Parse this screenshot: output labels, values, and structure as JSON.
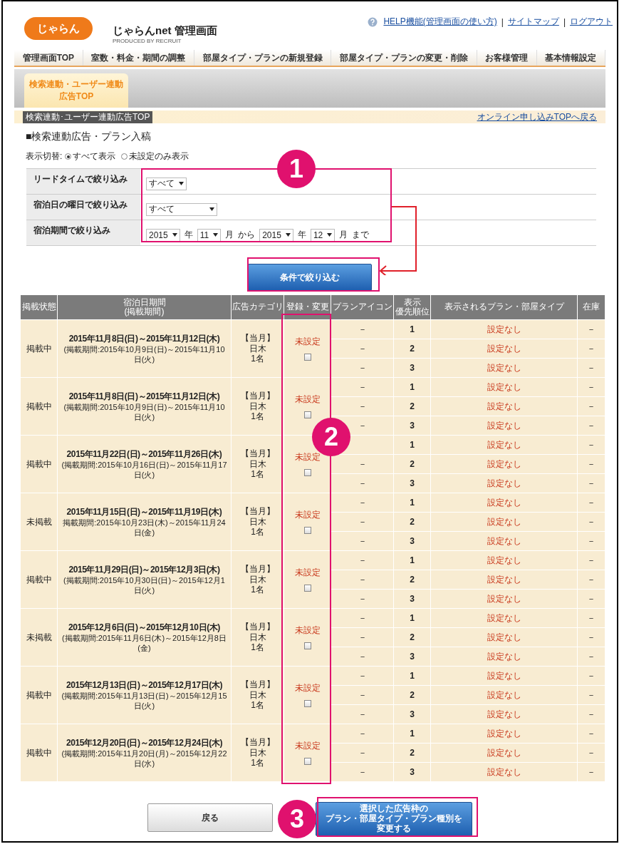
{
  "header": {
    "logo": "じゃらん",
    "title": "じゃらんnet 管理画面",
    "produced_by": "PRODUCED BY RECRUIT",
    "links": [
      {
        "kind": "help",
        "label": "HELP機能(管理画面の使い方)"
      },
      {
        "kind": "sep",
        "label": "|"
      },
      {
        "kind": "link",
        "label": "サイトマップ"
      },
      {
        "kind": "sep",
        "label": "|"
      },
      {
        "kind": "link",
        "label": "ログアウト"
      }
    ]
  },
  "nav": [
    "管理画面TOP",
    "室数・料金・期間の調整",
    "部屋タイプ・プランの新規登録",
    "部屋タイプ・プランの変更・削除",
    "お客様管理",
    "基本情報設定"
  ],
  "subtabs": [
    {
      "lines": [
        "検索連動・ユーザー連動",
        "広告TOP"
      ],
      "selected": true
    }
  ],
  "breadcrumb": {
    "current": "検索連動･ユーザー連動広告TOP",
    "back_link": "オンライン申し込みTOPへ戻る"
  },
  "heading": "■検索連動広告・プラン入稿",
  "display_toggle": {
    "label": "表示切替:",
    "options": [
      {
        "label": "すべて表示",
        "selected": true
      },
      {
        "label": "未設定のみ表示",
        "selected": false
      }
    ]
  },
  "filters": [
    {
      "label": "リードタイムで絞り込み",
      "controls": [
        {
          "kind": "select",
          "value": "すべて"
        }
      ]
    },
    {
      "label": "宿泊日の曜日で絞り込み",
      "controls": [
        {
          "kind": "select",
          "value": "すべて"
        }
      ]
    },
    {
      "label": "宿泊期間で絞り込み",
      "controls": [
        {
          "kind": "select",
          "value": "2015"
        },
        {
          "kind": "text",
          "value": "年"
        },
        {
          "kind": "select",
          "value": "11"
        },
        {
          "kind": "text",
          "value": "月"
        },
        {
          "kind": "text",
          "value": "から"
        },
        {
          "kind": "select",
          "value": "2015"
        },
        {
          "kind": "text",
          "value": "年"
        },
        {
          "kind": "select",
          "value": "12"
        },
        {
          "kind": "text",
          "value": "月"
        },
        {
          "kind": "text",
          "value": "まで"
        }
      ]
    }
  ],
  "filter_button": "条件で絞り込む",
  "table": {
    "columns": [
      {
        "lines": [
          "掲載状態"
        ]
      },
      {
        "lines": [
          "宿泊日期間",
          "(掲載期間)"
        ]
      },
      {
        "lines": [
          "広告カテゴリ"
        ]
      },
      {
        "lines": [
          "登録・変更"
        ]
      },
      {
        "lines": [
          "プランアイコン"
        ]
      },
      {
        "lines": [
          "表示",
          "優先順位"
        ]
      },
      {
        "lines": [
          "表示されるプラン・部屋タイプ"
        ]
      },
      {
        "lines": [
          "在庫"
        ]
      }
    ],
    "rows": [
      {
        "status": "掲載中",
        "stay": "2015年11月8日(日)～2015年11月12日(木)",
        "published": "(掲載期間:2015年10月9日(日)～2015年11月10日(火)",
        "category": [
          "【当月】",
          "日木",
          "1名"
        ],
        "registration": "未設定",
        "checked": false,
        "slots": [
          {
            "icon": "－",
            "priority": "1",
            "plan": "設定なし",
            "stock": "－"
          },
          {
            "icon": "－",
            "priority": "2",
            "plan": "設定なし",
            "stock": "－"
          },
          {
            "icon": "－",
            "priority": "3",
            "plan": "設定なし",
            "stock": "－"
          }
        ]
      },
      {
        "status": "掲載中",
        "stay": "2015年11月8日(日)～2015年11月12日(木)",
        "published": "(掲載期間:2015年10月9日(日)～2015年11月10日(火)",
        "category": [
          "【当月】",
          "日木",
          "1名"
        ],
        "registration": "未設定",
        "checked": false,
        "slots": [
          {
            "icon": "－",
            "priority": "1",
            "plan": "設定なし",
            "stock": "－"
          },
          {
            "icon": "－",
            "priority": "2",
            "plan": "設定なし",
            "stock": "－"
          },
          {
            "icon": "－",
            "priority": "3",
            "plan": "設定なし",
            "stock": "－"
          }
        ]
      },
      {
        "status": "掲載中",
        "stay": "2015年11月22日(日)～2015年11月26日(木)",
        "published": "(掲載期間:2015年10月16日(日)～2015年11月17日(火)",
        "category": [
          "【当月】",
          "日木",
          "1名"
        ],
        "registration": "未設定",
        "checked": false,
        "slots": [
          {
            "priority": "1",
            "plan": "設定なし",
            "stock": "－"
          },
          {
            "icon": "－",
            "priority": "2",
            "plan": "設定なし",
            "stock": "－"
          },
          {
            "icon": "－",
            "priority": "3",
            "plan": "設定なし",
            "stock": "－"
          }
        ]
      },
      {
        "status": "未掲載",
        "stay": "2015年11月15日(日)～2015年11月19日(木)",
        "published": "掲載期間:2015年10月23日(木)～2015年11月24日(金)",
        "category": [
          "【当月】",
          "日木",
          "1名"
        ],
        "registration": "未設定",
        "checked": false,
        "slots": [
          {
            "icon": "－",
            "priority": "1",
            "plan": "設定なし",
            "stock": "－"
          },
          {
            "icon": "－",
            "priority": "2",
            "plan": "設定なし",
            "stock": "－"
          },
          {
            "icon": "－",
            "priority": "3",
            "plan": "設定なし",
            "stock": "－"
          }
        ]
      },
      {
        "status": "掲載中",
        "stay": "2015年11月29日(日)～2015年12月3日(木)",
        "published": "(掲載期間:2015年10月30日(日)～2015年12月1日(火)",
        "category": [
          "【当月】",
          "日木",
          "1名"
        ],
        "registration": "未設定",
        "checked": false,
        "slots": [
          {
            "icon": "－",
            "priority": "1",
            "plan": "設定なし",
            "stock": "－"
          },
          {
            "icon": "－",
            "priority": "2",
            "plan": "設定なし",
            "stock": "－"
          },
          {
            "icon": "－",
            "priority": "3",
            "plan": "設定なし",
            "stock": "－"
          }
        ]
      },
      {
        "status": "未掲載",
        "stay": "2015年12月6日(日)～2015年12月10日(木)",
        "published": "(掲載期間:2015年11月6日(木)～2015年12月8日(金)",
        "category": [
          "【当月】",
          "日木",
          "1名"
        ],
        "registration": "未設定",
        "checked": false,
        "slots": [
          {
            "icon": "－",
            "priority": "1",
            "plan": "設定なし",
            "stock": "－"
          },
          {
            "icon": "－",
            "priority": "2",
            "plan": "設定なし",
            "stock": "－"
          },
          {
            "icon": "－",
            "priority": "3",
            "plan": "設定なし",
            "stock": "－"
          }
        ]
      },
      {
        "status": "掲載中",
        "stay": "2015年12月13日(日)～2015年12月17日(木)",
        "published": "(掲載期間:2015年11月13日(日)～2015年12月15日(火)",
        "category": [
          "【当月】",
          "日木",
          "1名"
        ],
        "registration": "未設定",
        "checked": false,
        "slots": [
          {
            "icon": "－",
            "priority": "1",
            "plan": "設定なし",
            "stock": "－"
          },
          {
            "icon": "－",
            "priority": "2",
            "plan": "設定なし",
            "stock": "－"
          },
          {
            "icon": "－",
            "priority": "3",
            "plan": "設定なし",
            "stock": "－"
          }
        ]
      },
      {
        "status": "掲載中",
        "stay": "2015年12月20日(日)～2015年12月24日(木)",
        "published": "(掲載期間:2015年11月20日(月)～2015年12月22日(水)",
        "category": [
          "【当月】",
          "日木",
          "1名"
        ],
        "registration": "未設定",
        "checked": false,
        "slots": [
          {
            "icon": "－",
            "priority": "1",
            "plan": "設定なし",
            "stock": "－"
          },
          {
            "icon": "－",
            "priority": "2",
            "plan": "設定なし",
            "stock": "－"
          },
          {
            "icon": "－",
            "priority": "3",
            "plan": "設定なし",
            "stock": "－"
          }
        ]
      }
    ]
  },
  "footer_buttons": [
    {
      "kind": "back",
      "lines": [
        "戻る"
      ]
    },
    {
      "kind": "primary",
      "lines": [
        "選択した広告枠の",
        "プラン・部屋タイプ・プラン種別を",
        "変更する"
      ]
    }
  ],
  "annotations": [
    {
      "number": "1"
    },
    {
      "number": "2"
    },
    {
      "number": "3"
    }
  ]
}
